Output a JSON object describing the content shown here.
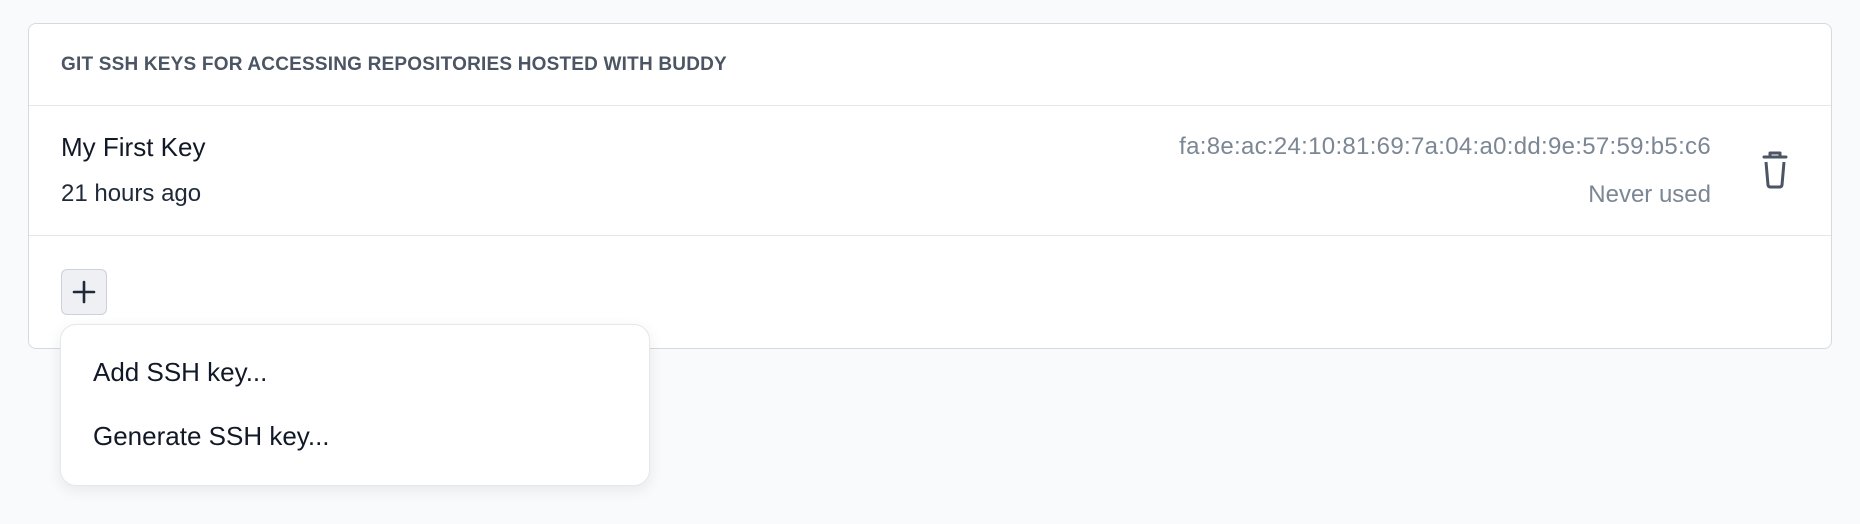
{
  "section": {
    "title": "GIT SSH KEYS FOR ACCESSING REPOSITORIES HOSTED WITH BUDDY"
  },
  "keys": [
    {
      "name": "My First Key",
      "created": "21 hours ago",
      "fingerprint": "fa:8e:ac:24:10:81:69:7a:04:a0:dd:9e:57:59:b5:c6",
      "usage": "Never used"
    }
  ],
  "actions": {
    "add_icon": "plus-icon",
    "delete_icon": "trash-icon"
  },
  "dropdown": {
    "items": [
      {
        "label": "Add SSH key..."
      },
      {
        "label": "Generate SSH key..."
      }
    ]
  },
  "colors": {
    "background": "#f9fafb",
    "card": "#ffffff",
    "muted_text": "#7b8794",
    "icon": "#4b5563"
  }
}
